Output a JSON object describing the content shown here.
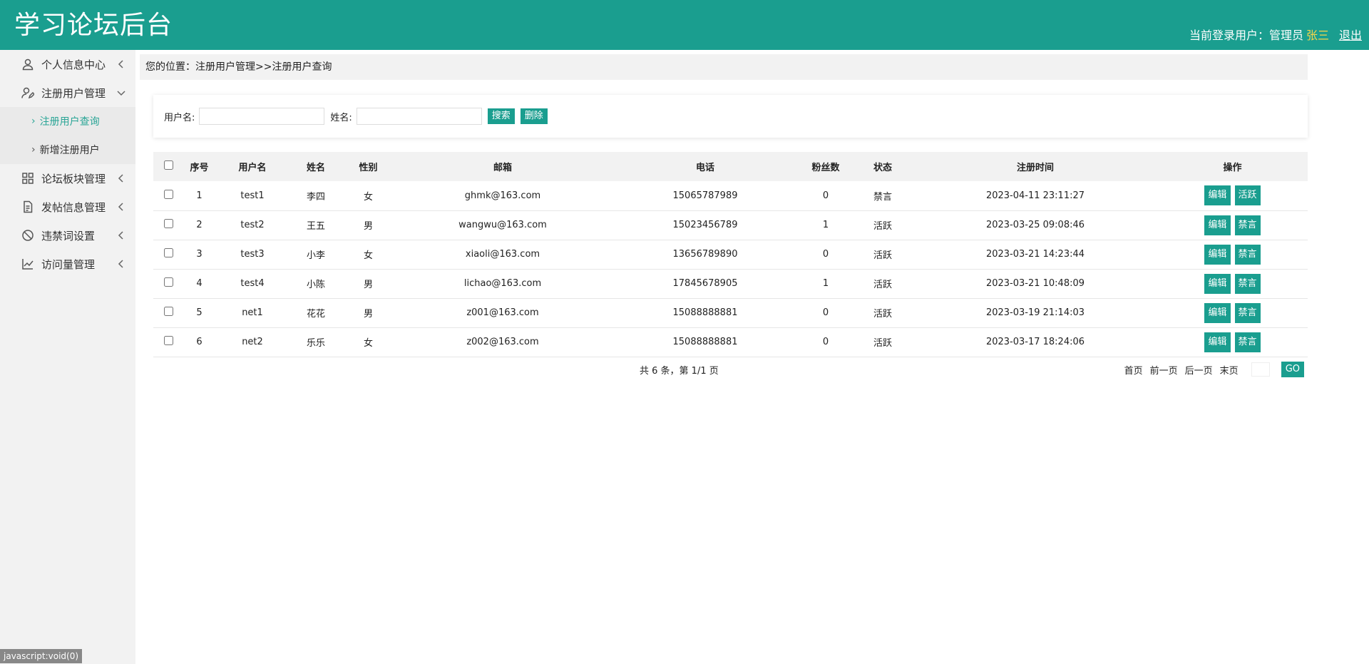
{
  "header": {
    "title": "学习论坛后台",
    "user_label": "当前登录用户：管理员",
    "user_name": "张三",
    "logout": "退出"
  },
  "sidebar": {
    "items": [
      {
        "label": "个人信息中心",
        "icon": "user-icon"
      },
      {
        "label": "注册用户管理",
        "icon": "user-edit-icon"
      },
      {
        "label": "论坛板块管理",
        "icon": "grid-icon"
      },
      {
        "label": "发帖信息管理",
        "icon": "document-icon"
      },
      {
        "label": "违禁词设置",
        "icon": "ban-icon"
      },
      {
        "label": "访问量管理",
        "icon": "chart-line-icon"
      }
    ],
    "sub_items": [
      {
        "label": "注册用户查询",
        "active": true
      },
      {
        "label": "新增注册用户",
        "active": false
      }
    ]
  },
  "breadcrumb": "您的位置：注册用户管理>>注册用户查询",
  "search": {
    "username_label": "用户名:",
    "name_label": "姓名:",
    "search_btn": "搜索",
    "delete_btn": "删除"
  },
  "table": {
    "headers": [
      "序号",
      "用户名",
      "姓名",
      "性别",
      "邮箱",
      "电话",
      "粉丝数",
      "状态",
      "注册时间",
      "操作"
    ],
    "edit_label": "编辑",
    "rows": [
      {
        "idx": "1",
        "username": "test1",
        "name": "李四",
        "gender": "女",
        "email": "ghmk@163.com",
        "phone": "15065787989",
        "fans": "0",
        "status": "禁言",
        "time": "2023-04-11 23:11:27",
        "action": "活跃"
      },
      {
        "idx": "2",
        "username": "test2",
        "name": "王五",
        "gender": "男",
        "email": "wangwu@163.com",
        "phone": "15023456789",
        "fans": "1",
        "status": "活跃",
        "time": "2023-03-25 09:08:46",
        "action": "禁言"
      },
      {
        "idx": "3",
        "username": "test3",
        "name": "小李",
        "gender": "女",
        "email": "xiaoli@163.com",
        "phone": "13656789890",
        "fans": "0",
        "status": "活跃",
        "time": "2023-03-21 14:23:44",
        "action": "禁言"
      },
      {
        "idx": "4",
        "username": "test4",
        "name": "小陈",
        "gender": "男",
        "email": "lichao@163.com",
        "phone": "17845678905",
        "fans": "1",
        "status": "活跃",
        "time": "2023-03-21 10:48:09",
        "action": "禁言"
      },
      {
        "idx": "5",
        "username": "net1",
        "name": "花花",
        "gender": "男",
        "email": "z001@163.com",
        "phone": "15088888881",
        "fans": "0",
        "status": "活跃",
        "time": "2023-03-19 21:14:03",
        "action": "禁言"
      },
      {
        "idx": "6",
        "username": "net2",
        "name": "乐乐",
        "gender": "女",
        "email": "z002@163.com",
        "phone": "15088888881",
        "fans": "0",
        "status": "活跃",
        "time": "2023-03-17 18:24:06",
        "action": "禁言"
      }
    ]
  },
  "pager": {
    "summary": "共 6 条，第 1/1 页",
    "first": "首页",
    "prev": "前一页",
    "next": "后一页",
    "last": "末页",
    "go": "GO"
  },
  "status_tip": "javascript:void(0)",
  "colors": {
    "brand": "#1a9e8f",
    "username_highlight": "#f7d54a",
    "active_link": "#2aa596"
  }
}
